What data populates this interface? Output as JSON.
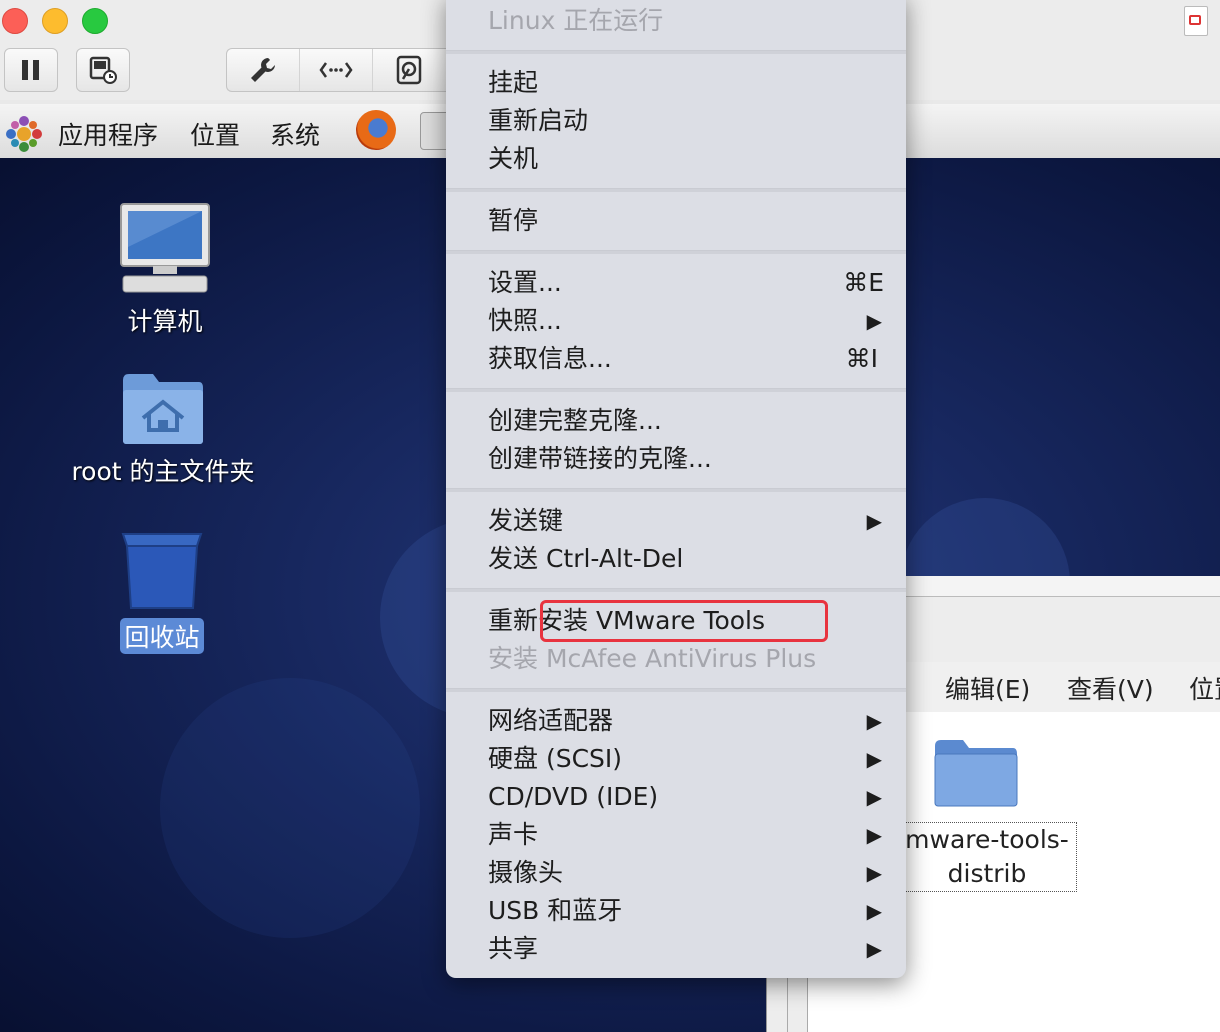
{
  "host_toolbar": {
    "buttons": [
      "pause-icon",
      "snapshot-icon",
      "wrench-icon",
      "network-arrows-icon",
      "disk-icon"
    ]
  },
  "gnome_panel": {
    "applications": "应用程序",
    "places": "位置",
    "system": "系统"
  },
  "desktop": {
    "computer_label": "计算机",
    "home_label": "root 的主文件夹",
    "trash_label": "回收站"
  },
  "file_window": {
    "menu_partial": ")",
    "menu_edit": "编辑(E)",
    "menu_view": "查看(V)",
    "menu_places_partial": "位置",
    "folder_label_line1": "mware-tools-",
    "folder_label_line2": "distrib"
  },
  "context_menu": {
    "status": "Linux 正在运行",
    "suspend": "挂起",
    "restart": "重新启动",
    "shutdown": "关机",
    "pause": "暂停",
    "settings": "设置...",
    "settings_shortcut": "⌘E",
    "snapshots": "快照...",
    "get_info": "获取信息...",
    "get_info_shortcut": "⌘I",
    "full_clone": "创建完整克隆...",
    "linked_clone": "创建带链接的克隆...",
    "send_key": "发送键",
    "send_cad": "发送 Ctrl-Alt-Del",
    "reinstall_tools": "重新安装 VMware Tools",
    "install_mcafee": "安装 McAfee AntiVirus Plus",
    "network_adapter": "网络适配器",
    "hard_disk": "硬盘 (SCSI)",
    "cd_dvd": "CD/DVD (IDE)",
    "sound_card": "声卡",
    "camera": "摄像头",
    "usb_bluetooth": "USB 和蓝牙",
    "sharing": "共享",
    "submenu_arrow": "▶"
  },
  "colors": {
    "highlight_box": "#e8333f",
    "menu_bg": "#dcdee5",
    "desktop_bg": "#17275e"
  }
}
